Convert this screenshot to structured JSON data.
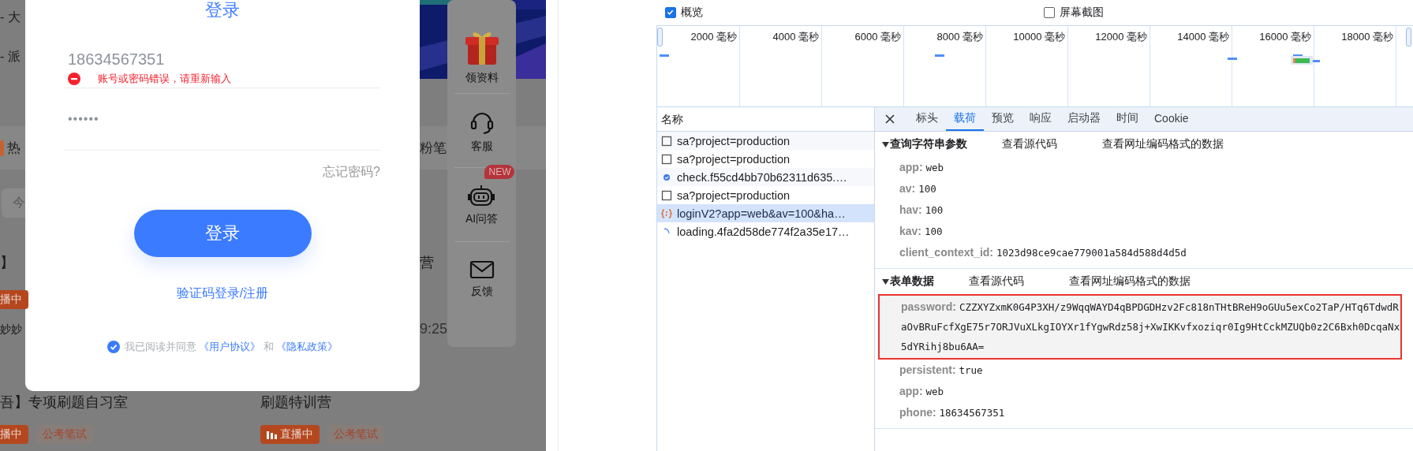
{
  "background_page": {
    "menu_items": [
      "- 大",
      "- 派"
    ],
    "hot_heading": {
      "left": "热",
      "right": "粉笔"
    },
    "filter_fragment": "今",
    "course_cards": [
      {
        "title": "】",
        "tags": [
          {
            "label": "播中",
            "kind": "live"
          }
        ],
        "teacher": "妙妙"
      },
      {
        "title": "营",
        "time": "9:25"
      },
      {
        "title": "吾】专项刷题自习室",
        "tags": [
          {
            "label": "播中",
            "kind": "live"
          },
          {
            "label": "公考笔试",
            "kind": "category"
          }
        ]
      },
      {
        "title": "刷题特训营",
        "tags": [
          {
            "label": "直播中",
            "kind": "live"
          },
          {
            "label": "公考笔试",
            "kind": "category"
          }
        ]
      }
    ],
    "side_panel": [
      {
        "label": "领资料",
        "kind": "gift"
      },
      {
        "label": "客服",
        "kind": "headset"
      },
      {
        "label": "AI问答",
        "kind": "robot",
        "badge": "NEW"
      },
      {
        "label": "反馈",
        "kind": "mail"
      }
    ]
  },
  "login_dialog": {
    "title": "登录",
    "phone": {
      "value": "18634567351"
    },
    "error": "账号或密码错误，请重新输入",
    "password": {
      "value": "••••••"
    },
    "forgot_link": "忘记密码?",
    "login_button": "登录",
    "alt_login_link": "验证码登录/注册",
    "agreement": {
      "checked": true,
      "text": "我已阅读并同意",
      "links": [
        "《用户协议》",
        "《隐私政策》"
      ],
      "joiner": "和"
    }
  },
  "devtools": {
    "overview_checkbox": {
      "label": "概览",
      "checked": true
    },
    "screenshot_checkbox": {
      "label": "屏幕截图",
      "checked": false
    },
    "timeline_ticks": [
      "2000 毫秒",
      "4000 毫秒",
      "6000 毫秒",
      "8000 毫秒",
      "10000 毫秒",
      "12000 毫秒",
      "14000 毫秒",
      "16000 毫秒",
      "18000 毫秒"
    ],
    "requests": {
      "header": "名称",
      "rows": [
        {
          "name": "sa?project=production",
          "kind": "document",
          "selected": false
        },
        {
          "name": "sa?project=production",
          "kind": "document",
          "selected": false
        },
        {
          "name": "check.f55cd4bb70b62311d635.…",
          "kind": "script",
          "selected": false
        },
        {
          "name": "sa?project=production",
          "kind": "document",
          "selected": false
        },
        {
          "name": "loginV2?app=web&av=100&ha…",
          "kind": "fetch",
          "selected": true
        },
        {
          "name": "loading.4fa2d58de774f2a35e17…",
          "kind": "pending",
          "selected": false
        }
      ]
    },
    "tabs": [
      {
        "label": "标头",
        "selected": false
      },
      {
        "label": "载荷",
        "selected": true
      },
      {
        "label": "预览",
        "selected": false
      },
      {
        "label": "响应",
        "selected": false
      },
      {
        "label": "启动器",
        "selected": false
      },
      {
        "label": "时间",
        "selected": false
      },
      {
        "label": "Cookie",
        "selected": false
      }
    ],
    "sections": [
      {
        "title": "查询字符串参数",
        "expanded": true,
        "links": [
          "查看源代码",
          "查看网址编码格式的数据"
        ],
        "params": [
          {
            "key": "app:",
            "value": "web"
          },
          {
            "key": "av:",
            "value": "100"
          },
          {
            "key": "hav:",
            "value": "100"
          },
          {
            "key": "kav:",
            "value": "100"
          },
          {
            "key": "client_context_id:",
            "value": "1023d98ce9cae779001a584d588d4d5d"
          }
        ]
      },
      {
        "title": "表单数据",
        "expanded": true,
        "links": [
          "查看源代码",
          "查看网址编码格式的数据"
        ],
        "params": [
          {
            "key": "password:",
            "value": "CZZXYZxmK0G4P3XH/z9WqqWAYD4qBPDGDHzv2Fc818nTHtBReH9oGUu5exCo2TaP/HTq6TdwdRaOvBRuFcfXgE75r7ORJVuXLkgIOYXr1fYgwRdz58j+XwIKKvfxoziqr0Ig9HtCckMZUQb0z2C6Bxh0DcqaNx5dYRihj8bu6AA=",
            "highlighted": true
          },
          {
            "key": "persistent:",
            "value": "true"
          },
          {
            "key": "app:",
            "value": "web"
          },
          {
            "key": "phone:",
            "value": "18634567351"
          }
        ]
      }
    ]
  }
}
